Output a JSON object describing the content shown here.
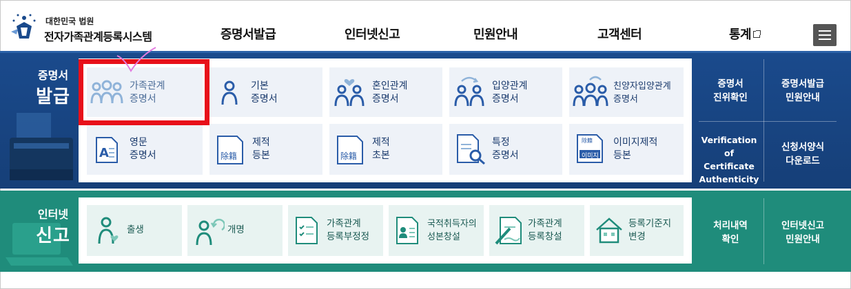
{
  "header": {
    "org": "대한민국 법원",
    "system_name": "전자가족관계등록시스템",
    "nav": [
      {
        "label": "증명서발급"
      },
      {
        "label": "인터넷신고"
      },
      {
        "label": "민원안내"
      },
      {
        "label": "고객센터"
      },
      {
        "label": "통계"
      }
    ]
  },
  "issue_section": {
    "label_small": "증명서",
    "label_big": "발급",
    "tiles": [
      {
        "line1": "가족관계",
        "line2": "증명서",
        "icon": "family-icon"
      },
      {
        "line1": "기본",
        "line2": "증명서",
        "icon": "person-icon"
      },
      {
        "line1": "혼인관계",
        "line2": "증명서",
        "icon": "couple-heart-icon"
      },
      {
        "line1": "입양관계",
        "line2": "증명서",
        "icon": "adoption-icon"
      },
      {
        "line1": "친양자입양관계",
        "line2": "증명서",
        "icon": "family-adoption-icon"
      },
      {
        "line1": "영문",
        "line2": "증명서",
        "icon": "english-document-icon"
      },
      {
        "line1": "제적",
        "line2": "등본",
        "icon": "removed-register-icon",
        "badge": "除籍"
      },
      {
        "line1": "제적",
        "line2": "초본",
        "icon": "removed-register-icon",
        "badge": "除籍"
      },
      {
        "line1": "특정",
        "line2": "증명서",
        "icon": "document-search-icon"
      },
      {
        "line1": "이미지제적",
        "line2": "등본",
        "icon": "image-register-icon",
        "badge": "이미지",
        "badge_top": "除籍"
      }
    ],
    "right": [
      {
        "line1": "증명서",
        "line2": "진위확인"
      },
      {
        "line1": "증명서발급",
        "line2": "민원안내"
      },
      {
        "line1": "Verification of",
        "line2": "Certificate",
        "line3": "Authenticity"
      },
      {
        "line1": "신청서양식",
        "line2": "다운로드"
      }
    ]
  },
  "report_section": {
    "label_small": "인터넷",
    "label_big": "신고",
    "tiles": [
      {
        "line1": "출생",
        "line2": "",
        "icon": "baby-heart-icon"
      },
      {
        "line1": "개명",
        "line2": "",
        "icon": "rename-person-icon"
      },
      {
        "line1": "가족관계",
        "line2": "등록부정정",
        "icon": "checklist-document-icon"
      },
      {
        "line1": "국적취득자의",
        "line2": "성본창설",
        "icon": "id-card-icon"
      },
      {
        "line1": "가족관계",
        "line2": "등록창설",
        "icon": "pen-document-icon"
      },
      {
        "line1": "등록기준지",
        "line2": "변경",
        "icon": "house-icon"
      }
    ],
    "right": [
      {
        "line1": "처리내역",
        "line2": "확인"
      },
      {
        "line1": "인터넷신고",
        "line2": "민원안내"
      }
    ]
  },
  "colors": {
    "issue_band": "#1a4a8c",
    "report_band": "#1f8c7b",
    "highlight": "#e8101a",
    "tile_blue": "#eef2f8",
    "tile_green": "#e8f3f1",
    "icon_blue": "#2a5ca8",
    "icon_green": "#1f8c7b"
  }
}
